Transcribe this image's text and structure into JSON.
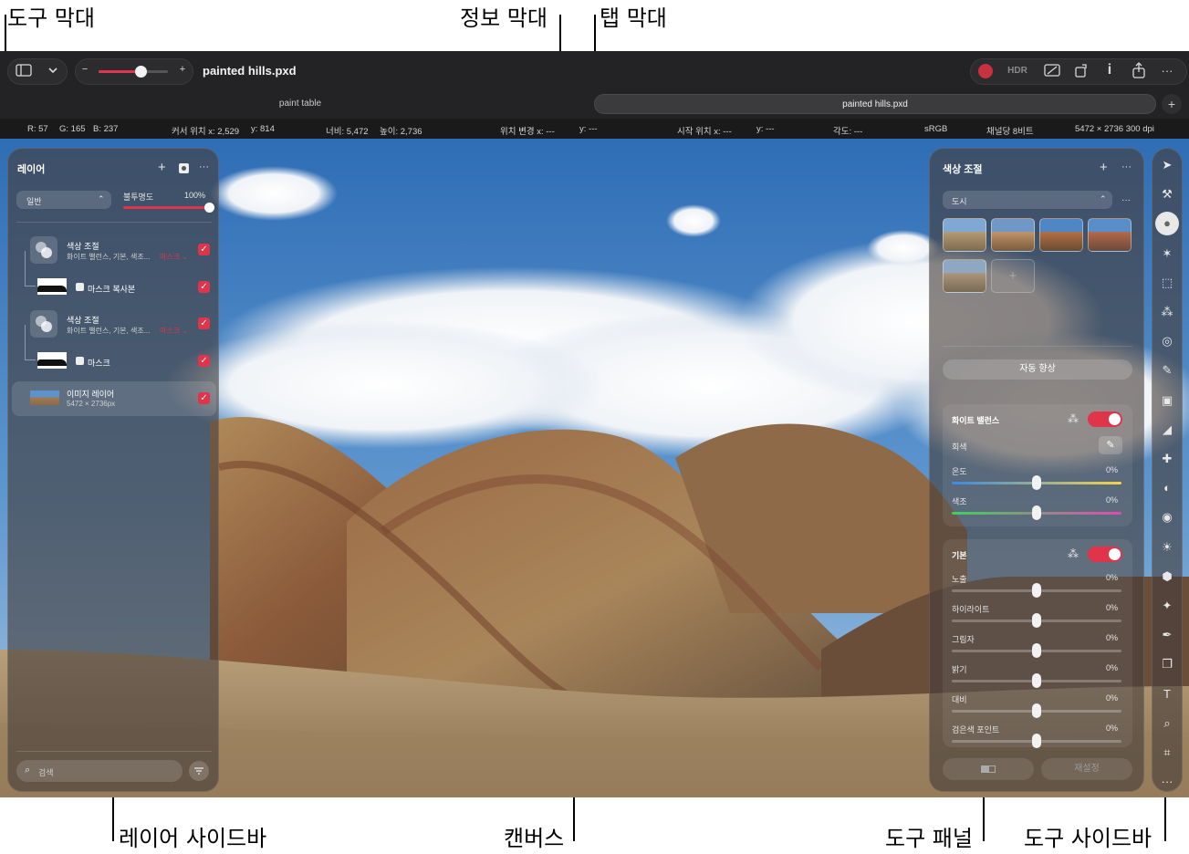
{
  "callouts": {
    "toolbar": "도구 막대",
    "infobar": "정보 막대",
    "tabbar": "탭 막대",
    "layers_sidebar": "레이어 사이드바",
    "canvas": "캔버스",
    "tool_panel": "도구 패널",
    "tools_sidebar": "도구 사이드바"
  },
  "toolbar": {
    "document_title": "painted hills.pxd",
    "zoom_minus": "−",
    "zoom_plus": "+",
    "zoom_level": 0.6,
    "hdr_label": "HDR",
    "info_label": "i",
    "more_label": "···"
  },
  "tabs": [
    {
      "label": "paint table",
      "active": false
    },
    {
      "label": "painted hills.pxd",
      "active": true
    }
  ],
  "tab_add": "+",
  "infobar": {
    "rgb_r": "R: 57",
    "rgb_g": "G: 165",
    "rgb_b": "B: 237",
    "cursor_x": "커서 위치 x: 2,529",
    "cursor_y": "y: 814",
    "width": "너비: 5,472",
    "height": "높이: 2,736",
    "delta_x": "위치 변경 x: ---",
    "delta_y": "y: ---",
    "start_x": "시작 위치 x: ---",
    "start_y": "y: ---",
    "angle": "각도: ---",
    "colorspace": "sRGB",
    "bit_depth": "채널당 8비트",
    "dimensions": "5472 × 2736 300 dpi"
  },
  "layers": {
    "title": "레이어",
    "add": "+",
    "more": "···",
    "blend_mode": "일반",
    "opacity_label": "불투명도",
    "opacity_value": "100%",
    "opacity": 1.0,
    "items": [
      {
        "name": "색상 조절",
        "desc": "화이트 밸런스, 기본, 색조...",
        "tag": "마스크 ⌄"
      },
      {
        "name": "마스크 복사본"
      },
      {
        "name": "색상 조절",
        "desc": "화이트 밸런스, 기본, 색조...",
        "tag": "마스크 ⌄"
      },
      {
        "name": "마스크"
      },
      {
        "name": "이미지 레이어",
        "desc": "5472 × 2736px"
      }
    ],
    "search_placeholder": "검색"
  },
  "adjust": {
    "title": "색상 조절",
    "add": "+",
    "more": "···",
    "preset": "도시",
    "preset_add": "+",
    "auto_enhance": "자동 향상",
    "white_balance": {
      "title": "화이트 밸런스",
      "gray_label": "회색",
      "temp_label": "온도",
      "temp_value": "0%",
      "tint_label": "색조",
      "tint_value": "0%"
    },
    "basic": {
      "title": "기본",
      "rows": [
        {
          "label": "노출",
          "value": "0%"
        },
        {
          "label": "하이라이트",
          "value": "0%"
        },
        {
          "label": "그림자",
          "value": "0%"
        },
        {
          "label": "밝기",
          "value": "0%"
        },
        {
          "label": "대비",
          "value": "0%"
        },
        {
          "label": "검은색 포인트",
          "value": "0%"
        }
      ]
    },
    "reset": "재설정"
  },
  "tools": [
    {
      "icon": "arrow-icon",
      "glyph": "➤"
    },
    {
      "icon": "magic-icon",
      "glyph": "⚒"
    },
    {
      "icon": "color-adjust-icon",
      "glyph": "●"
    },
    {
      "icon": "effects-icon",
      "glyph": "✶"
    },
    {
      "icon": "selection-icon",
      "glyph": "⬚"
    },
    {
      "icon": "smart-select-icon",
      "glyph": "⁂"
    },
    {
      "icon": "retouch-icon",
      "glyph": "◎"
    },
    {
      "icon": "paint-icon",
      "glyph": "✎"
    },
    {
      "icon": "fill-icon",
      "glyph": "▣"
    },
    {
      "icon": "erase-icon",
      "glyph": "◢"
    },
    {
      "icon": "heal-icon",
      "glyph": "✚"
    },
    {
      "icon": "clone-icon",
      "glyph": "◐"
    },
    {
      "icon": "blur-icon",
      "glyph": "◉"
    },
    {
      "icon": "light-icon",
      "glyph": "☀"
    },
    {
      "icon": "shape-icon",
      "glyph": "⬢"
    },
    {
      "icon": "warp-icon",
      "glyph": "✦"
    },
    {
      "icon": "pen-icon",
      "glyph": "✒"
    },
    {
      "icon": "layers-shape-icon",
      "glyph": "❐"
    },
    {
      "icon": "type-icon",
      "glyph": "T"
    },
    {
      "icon": "zoom-icon",
      "glyph": "⌕"
    },
    {
      "icon": "crop-icon",
      "glyph": "⌗"
    },
    {
      "icon": "more-icon",
      "glyph": "···"
    }
  ],
  "colors": {
    "accent": "#e0344a",
    "toolbar_bg": "#232325",
    "info_bg": "#1a1a1b"
  }
}
